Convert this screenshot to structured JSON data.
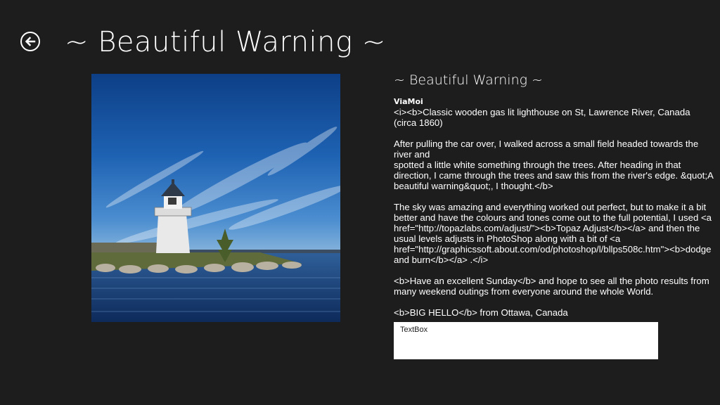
{
  "header": {
    "title": "~ Beautiful  Warning ~",
    "back_icon": "back-arrow-icon"
  },
  "photo": {
    "subject": "lighthouse"
  },
  "detail": {
    "title": "~ Beautiful  Warning ~",
    "author": "ViaMoi",
    "paragraphs": [
      "<i><b>Classic wooden gas lit lighthouse on St, Lawrence River, Canada (circa 1860)",
      "After pulling the car over,  I walked across a small field headed towards the river and\nspotted a little white something through the trees. After heading in that direction, I came through the trees and saw this from the river's edge. &quot;A beautiful warning&quot;,  I thought.</b>",
      "The sky was amazing and everything worked out perfect,  but to make it a bit better and have the colours and tones come out to the full potential, I used <a href=\"http://topazlabs.com/adjust/\"><b>Topaz Adjust</b></a> and then the usual levels adjusts in PhotoShop along with a bit of <a href=\"http://graphicssoft.about.com/od/photoshop/l/bllps508c.htm\"><b>dodge and burn</b></a>  .</i>",
      "<b>Have an excellent Sunday</b> and hope to see all the photo results from many weekend outings from everyone around the whole World.",
      "<b>BIG HELLO</b> from Ottawa, Canada"
    ]
  },
  "textbox": {
    "value": "TextBox"
  },
  "colors": {
    "background": "#1d1d1d",
    "text": "#ffffff",
    "textbox_bg": "#ffffff"
  }
}
